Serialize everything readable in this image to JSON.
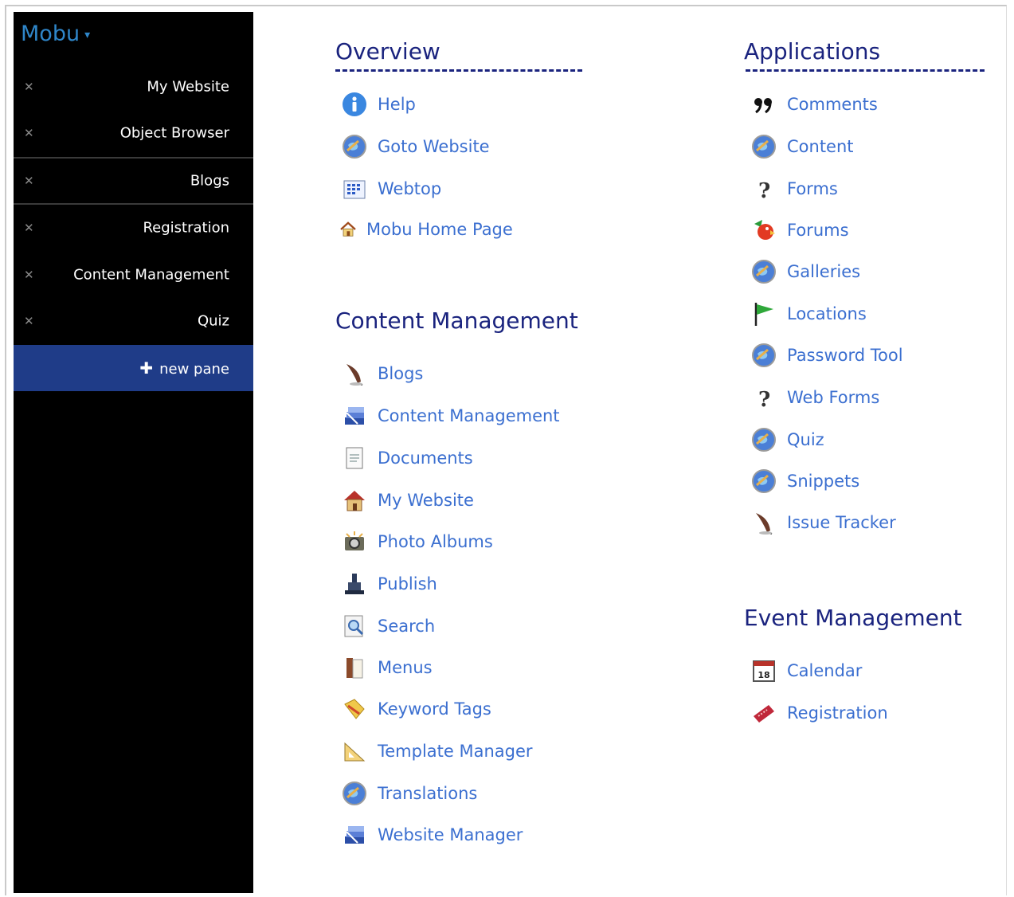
{
  "sidebar": {
    "brand": "Mobu",
    "panes": [
      {
        "label": "My Website"
      },
      {
        "label": "Object Browser"
      },
      {
        "label": "Blogs"
      },
      {
        "label": "Registration"
      },
      {
        "label": "Content Management"
      },
      {
        "label": "Quiz"
      }
    ],
    "new_pane_label": "new pane"
  },
  "overview": {
    "title": "Overview",
    "items": [
      {
        "label": "Help",
        "icon": "info-icon"
      },
      {
        "label": "Goto Website",
        "icon": "globe-icon"
      },
      {
        "label": "Webtop",
        "icon": "grid-icon"
      },
      {
        "label": "Mobu Home Page",
        "icon": "home-icon"
      }
    ]
  },
  "content_management": {
    "title": "Content Management",
    "items": [
      {
        "label": "Blogs",
        "icon": "quill-icon"
      },
      {
        "label": "Content Management",
        "icon": "stack-icon"
      },
      {
        "label": "Documents",
        "icon": "document-icon"
      },
      {
        "label": "My Website",
        "icon": "house-icon"
      },
      {
        "label": "Photo Albums",
        "icon": "camera-icon"
      },
      {
        "label": "Publish",
        "icon": "publish-icon"
      },
      {
        "label": "Search",
        "icon": "search-icon"
      },
      {
        "label": "Menus",
        "icon": "book-icon"
      },
      {
        "label": "Keyword Tags",
        "icon": "tag-icon"
      },
      {
        "label": "Template Manager",
        "icon": "ruler-icon"
      },
      {
        "label": "Translations",
        "icon": "globe-icon"
      },
      {
        "label": "Website Manager",
        "icon": "stack-icon"
      }
    ]
  },
  "applications": {
    "title": "Applications",
    "items": [
      {
        "label": "Comments",
        "icon": "quote-icon"
      },
      {
        "label": "Content",
        "icon": "globe-icon"
      },
      {
        "label": "Forms",
        "icon": "question-icon"
      },
      {
        "label": "Forums",
        "icon": "parrot-icon"
      },
      {
        "label": "Galleries",
        "icon": "globe-icon"
      },
      {
        "label": "Locations",
        "icon": "flag-icon"
      },
      {
        "label": "Password Tool",
        "icon": "globe-icon"
      },
      {
        "label": "Web Forms",
        "icon": "question-icon"
      },
      {
        "label": "Quiz",
        "icon": "globe-icon"
      },
      {
        "label": "Snippets",
        "icon": "globe-icon"
      },
      {
        "label": "Issue Tracker",
        "icon": "quill-icon"
      }
    ]
  },
  "event_management": {
    "title": "Event Management",
    "items": [
      {
        "label": "Calendar",
        "icon": "calendar-icon",
        "day": "18"
      },
      {
        "label": "Registration",
        "icon": "ticket-icon"
      }
    ]
  },
  "colors": {
    "sidebar_bg": "#000000",
    "brand": "#2f86c9",
    "new_pane_bg": "#1f3c88",
    "heading": "#1a237e",
    "link": "#3b6fd0"
  }
}
